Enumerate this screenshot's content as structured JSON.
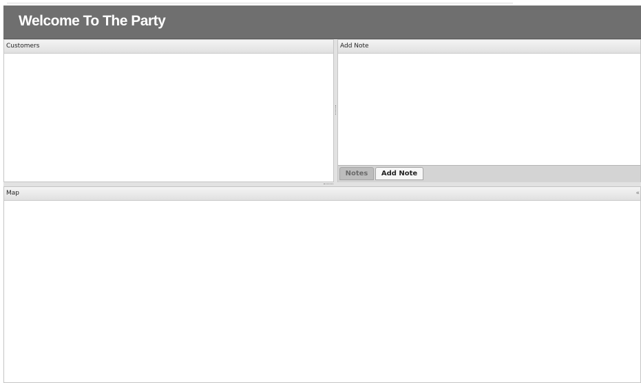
{
  "app": {
    "title": "Welcome To The Party"
  },
  "panels": {
    "customers": {
      "title": "Customers"
    },
    "add_note": {
      "title": "Add Note"
    },
    "map": {
      "title": "Map",
      "collapse_glyph": "«"
    }
  },
  "tabs": [
    {
      "label": "Notes",
      "selected": false
    },
    {
      "label": "Add Note",
      "selected": true
    }
  ],
  "icons": {
    "collapse": "collapse-icon",
    "vertical_splitter_grip": "grip-icon",
    "horizontal_splitter_grip": "grip-icon"
  },
  "colors": {
    "banner": "#6f6f6f",
    "banner_text": "#ffffff",
    "panel_header": "#e8e8e8",
    "tab_selected": "#f7f7f7",
    "tab_unselected": "#bdbdbd"
  }
}
